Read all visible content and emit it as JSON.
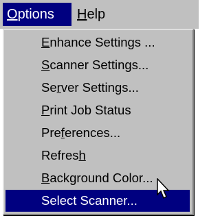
{
  "menubar": {
    "items": [
      {
        "pre": "",
        "key": "O",
        "post": "ptions",
        "active": true
      },
      {
        "pre": "",
        "key": "H",
        "post": "elp",
        "active": false
      }
    ]
  },
  "menu": {
    "items": [
      {
        "pre": "",
        "key": "E",
        "post": "nhance Settings ..."
      },
      {
        "pre": "",
        "key": "S",
        "post": "canner Settings..."
      },
      {
        "pre": "Se",
        "key": "r",
        "post": "ver Settings..."
      },
      {
        "pre": "",
        "key": "P",
        "post": "rint Job Status"
      },
      {
        "pre": "Pre",
        "key": "f",
        "post": "erences..."
      },
      {
        "pre": "Refres",
        "key": "h",
        "post": ""
      },
      {
        "pre": "",
        "key": "B",
        "post": "ackground Color..."
      },
      {
        "pre": "Select Scanner...",
        "key": "",
        "post": "",
        "highlighted": true
      }
    ]
  },
  "colors": {
    "menu_face": "#c0c0c0",
    "highlight": "#000080",
    "highlight_text": "#ffffff"
  },
  "icons": {
    "cursor": "arrow-cursor-icon"
  }
}
